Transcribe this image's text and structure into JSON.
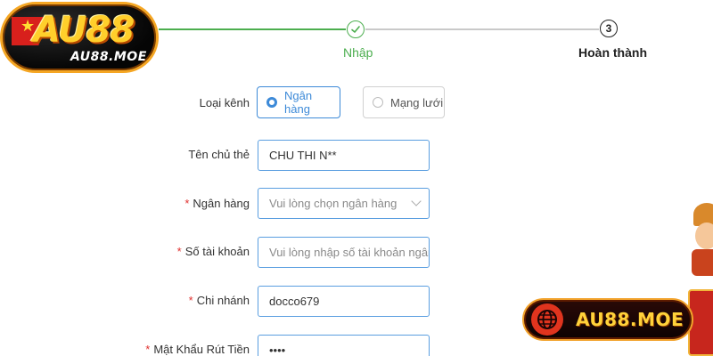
{
  "logo": {
    "brand": "AU88",
    "domain": "AU88.MOE"
  },
  "steps": [
    {
      "label": "Nhập",
      "state": "done"
    },
    {
      "number": "3",
      "label": "Hoàn thành",
      "state": "pending"
    }
  ],
  "form": {
    "channel": {
      "label": "Loại kênh",
      "options": [
        {
          "label": "Ngân hàng",
          "selected": true
        },
        {
          "label": "Mạng lưới",
          "selected": false
        }
      ]
    },
    "holder": {
      "label": "Tên chủ thẻ",
      "value": "CHU THI N**"
    },
    "bank": {
      "required_mark": "*",
      "label": "Ngân hàng",
      "placeholder": "Vui lòng chọn ngân hàng"
    },
    "account": {
      "required_mark": "*",
      "label": "Số tài khoản",
      "placeholder": "Vui lòng nhập số tài khoản ngân hà"
    },
    "branch": {
      "required_mark": "*",
      "label": "Chi nhánh",
      "value": "docco679"
    },
    "password": {
      "required_mark": "*",
      "label": "Mật Khẩu Rút Tiền",
      "value": "••••"
    }
  },
  "banner": {
    "text": "AU88.MOE"
  },
  "colors": {
    "accent": "#3d8ad8",
    "success": "#4cae4f",
    "required": "#e0312f",
    "brand_gold": "#ffcf2b"
  },
  "icons": {
    "step_done": "check-icon",
    "banner": "globe-icon",
    "select": "chevron-down-icon"
  }
}
